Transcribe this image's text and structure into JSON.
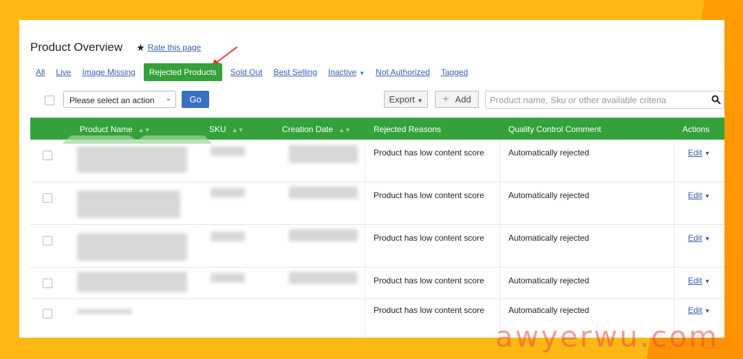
{
  "header": {
    "title": "Product Overview",
    "rate_label": "Rate this page"
  },
  "tabs": [
    {
      "label": "All",
      "active": false
    },
    {
      "label": "Live",
      "active": false
    },
    {
      "label": "Image Missing",
      "active": false
    },
    {
      "label": "Rejected Products",
      "active": true
    },
    {
      "label": "Sold Out",
      "active": false
    },
    {
      "label": "Best Selling",
      "active": false
    },
    {
      "label": "Inactive",
      "active": false,
      "dropdown": true
    },
    {
      "label": "Not Authorized",
      "active": false
    },
    {
      "label": "Tagged",
      "active": false
    }
  ],
  "toolbar": {
    "action_select": "Please select an action",
    "go_label": "Go",
    "export_label": "Export",
    "add_label": "Add",
    "search_placeholder": "Product name, Sku or other available criteria"
  },
  "table": {
    "columns": [
      "Product Name",
      "SKU",
      "Creation Date",
      "Rejected Reasons",
      "Quality Control Comment",
      "Actions"
    ],
    "rows": [
      {
        "reason": "Product has low content score",
        "comment": "Automatically rejected",
        "action": "Edit"
      },
      {
        "reason": "Product has low content score",
        "comment": "Automatically rejected",
        "action": "Edit"
      },
      {
        "reason": "Product has low content score",
        "comment": "Automatically rejected",
        "action": "Edit"
      },
      {
        "reason": "Product has low content score",
        "comment": "Automatically rejected",
        "action": "Edit"
      },
      {
        "reason": "Product has low content score",
        "comment": "Automatically rejected",
        "action": "Edit"
      }
    ]
  },
  "watermark": "awyerwu.com",
  "colors": {
    "background": "#FDB813",
    "accent_green": "#34a13b",
    "link_blue": "#3a5fae",
    "go_button": "#3a6fc4",
    "arrow_red": "#e53935"
  }
}
